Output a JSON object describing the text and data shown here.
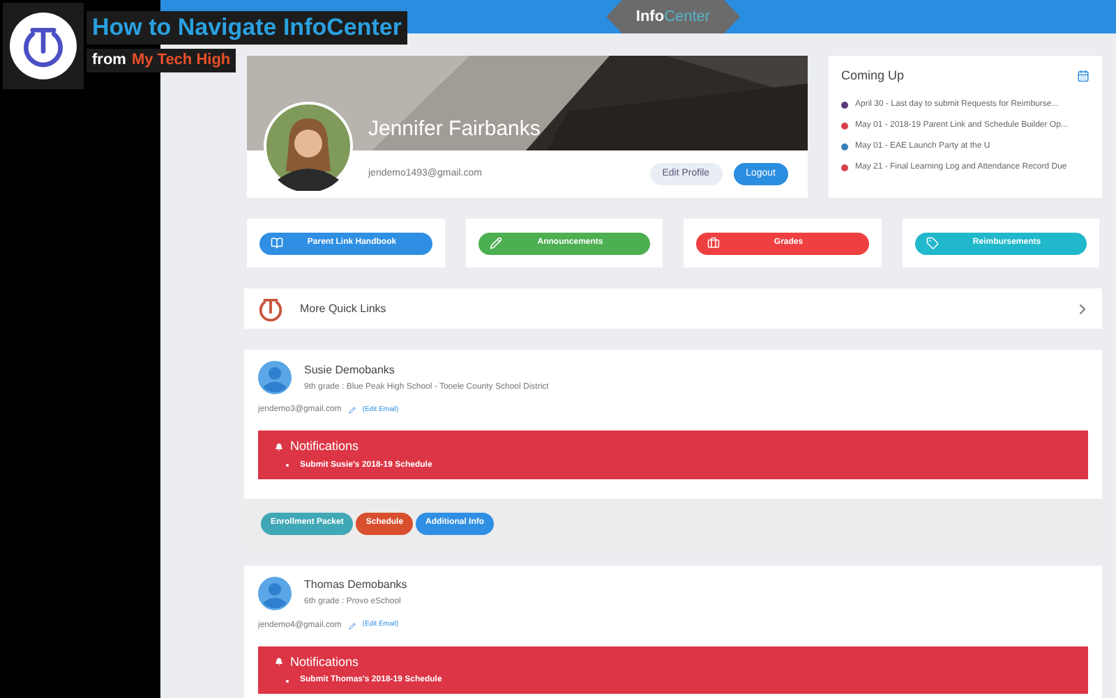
{
  "video_overlay": {
    "title": "How to Navigate InfoCenter",
    "from_label": "from",
    "channel": "My Tech High"
  },
  "header": {
    "logo_bold": "Info",
    "logo_light": "Center"
  },
  "profile": {
    "name": "Jennifer Fairbanks",
    "email": "jendemo1493@gmail.com",
    "buttons": [
      {
        "label": "Edit Profile",
        "kind": "secondary"
      },
      {
        "label": "Logout",
        "kind": "primary"
      }
    ]
  },
  "coming_up": {
    "title": "Coming Up",
    "events": [
      {
        "text": "April 30 - Last day to submit Requests for Reimburse...",
        "color": "#5a3a78"
      },
      {
        "text": "May 01 - 2018-19 Parent Link and Schedule Builder Op...",
        "color": "#d8404f"
      },
      {
        "text": "May 01 - EAE Launch Party at the U",
        "color": "#3a7fb8"
      },
      {
        "text": "May 21 - Final Learning Log and Attendance Record Due",
        "color": "#d8404f"
      }
    ]
  },
  "quick_links": [
    {
      "label": "Parent Link Handbook",
      "color": "#2f8fe3",
      "kind": "book"
    },
    {
      "label": "Announcements",
      "color": "#4caf50",
      "kind": "pencil"
    },
    {
      "label": "Grades",
      "color": "#ee4040",
      "kind": "briefcase"
    },
    {
      "label": "Reimbursements",
      "color": "#22b8cc",
      "kind": "tag"
    }
  ],
  "more_quick_links": {
    "label": "More Quick Links"
  },
  "students": [
    {
      "name": "Susie Demobanks",
      "details": "9th grade : Blue Peak High School - Tooele County School District",
      "email": "jendemo3@gmail.com",
      "edit_label": "(Edit Email)",
      "notifications": {
        "title": "Notifications",
        "items": [
          "Submit Susie's 2018-19 Schedule"
        ]
      },
      "actions": [
        {
          "label": "Enrollment Packet",
          "color": "#3fa7b5"
        },
        {
          "label": "Schedule",
          "color": "#d9502e"
        },
        {
          "label": "Additional Info",
          "color": "#2f8fe3"
        }
      ]
    },
    {
      "name": "Thomas Demobanks",
      "details": "6th grade : Provo eSchool",
      "email": "jendemo4@gmail.com",
      "edit_label": "(Edit Email)",
      "notifications": {
        "title": "Notifications",
        "items": [
          "Submit Thomas's 2018-19 Schedule"
        ]
      }
    }
  ]
}
